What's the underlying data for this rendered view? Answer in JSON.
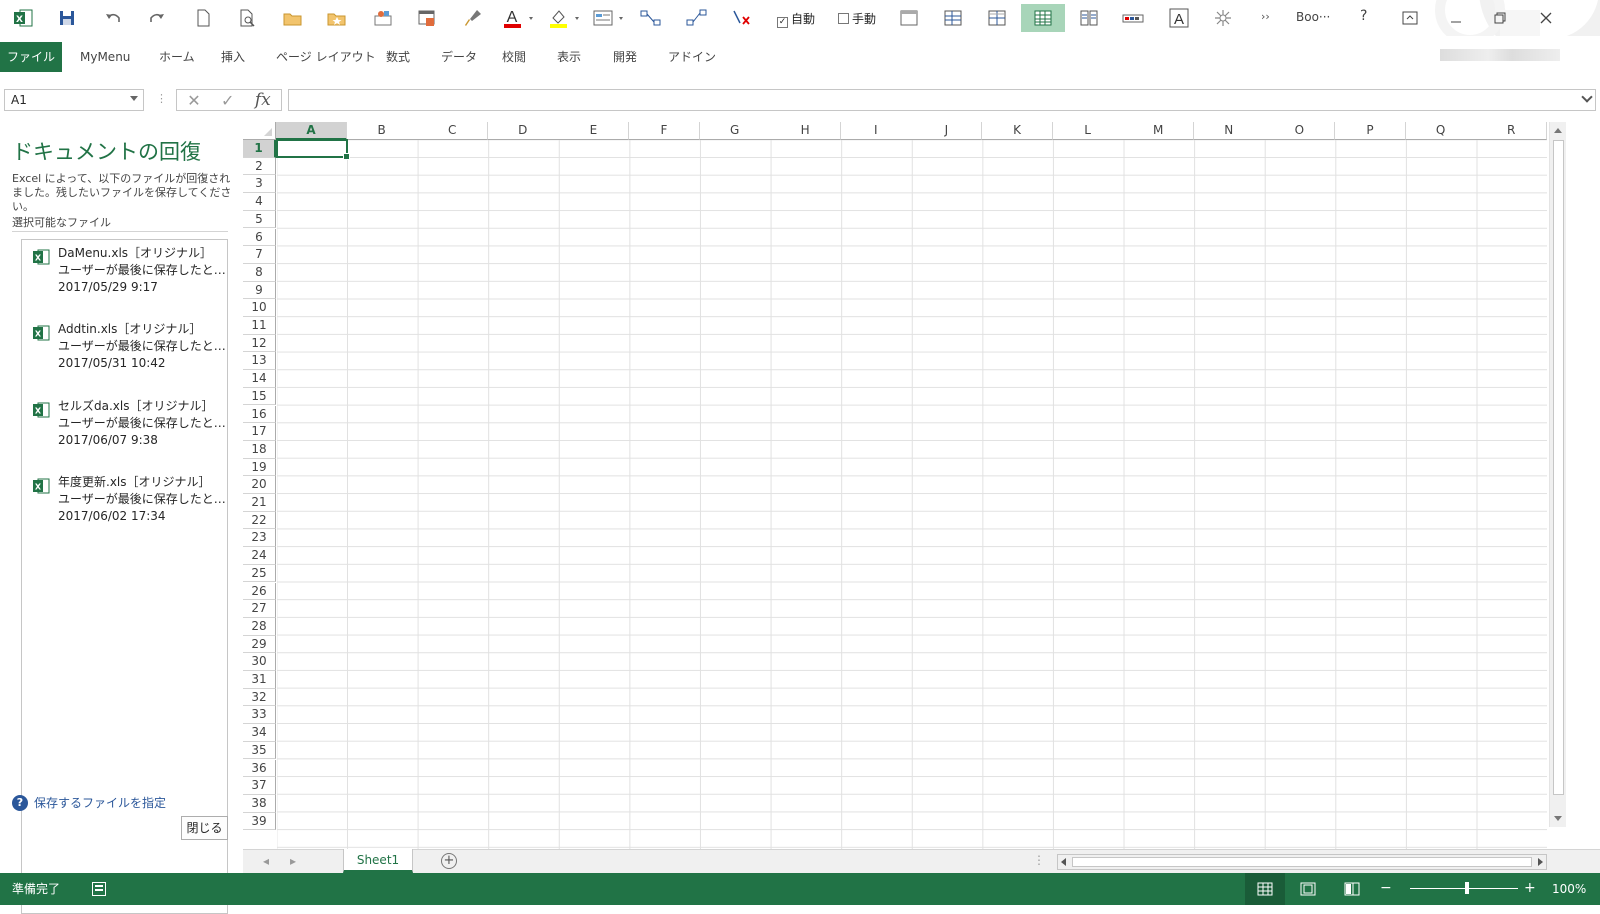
{
  "qat": {
    "check_auto_label": "自動",
    "check_manual_label": "手動",
    "doc_title": "Boo···",
    "help_label": "?",
    "overflow_label": "››"
  },
  "ribbon": {
    "tabs": [
      "ファイル",
      "MyMenu",
      "ホーム",
      "挿入",
      "ページ レイアウト",
      "数式",
      "データ",
      "校閲",
      "表示",
      "開発",
      "アドイン"
    ]
  },
  "formula_bar": {
    "name_box": "A1",
    "formula": ""
  },
  "recovery": {
    "title": "ドキュメントの回復",
    "description": "Excel によって、以下のファイルが回復されました。残したいファイルを保存してください。",
    "available_label": "選択可能なファイル",
    "files": [
      {
        "name": "DaMenu.xls［オリジナル］",
        "detail": "ユーザーが最後に保存したと…",
        "date": "2017/05/29 9:17"
      },
      {
        "name": "Addtin.xls［オリジナル］",
        "detail": "ユーザーが最後に保存したと…",
        "date": "2017/05/31 10:42"
      },
      {
        "name": "セルズda.xls［オリジナル］",
        "detail": "ユーザーが最後に保存したと…",
        "date": "2017/06/07 9:38"
      },
      {
        "name": "年度更新.xls［オリジナル］",
        "detail": "ユーザーが最後に保存したと…",
        "date": "2017/06/02 17:34"
      }
    ],
    "help_link": "保存するファイルを指定",
    "close_button": "閉じる"
  },
  "sheet": {
    "columns": [
      "A",
      "B",
      "C",
      "D",
      "E",
      "F",
      "G",
      "H",
      "I",
      "J",
      "K",
      "L",
      "M",
      "N",
      "O",
      "P",
      "Q",
      "R"
    ],
    "rows": [
      "1",
      "2",
      "3",
      "4",
      "5",
      "6",
      "7",
      "8",
      "9",
      "10",
      "11",
      "12",
      "13",
      "14",
      "15",
      "16",
      "17",
      "18",
      "19",
      "20",
      "21",
      "22",
      "23",
      "24",
      "25",
      "26",
      "27",
      "28",
      "29",
      "30",
      "31",
      "32",
      "33",
      "34",
      "35",
      "36",
      "37",
      "38",
      "39"
    ],
    "active_cell": "A1",
    "tab_name": "Sheet1",
    "add_sheet": "+"
  },
  "status": {
    "ready": "準備完了",
    "zoom": "100%",
    "zoom_minus": "−",
    "zoom_plus": "+"
  },
  "colors": {
    "accent": "#217346",
    "link": "#2b579a"
  }
}
